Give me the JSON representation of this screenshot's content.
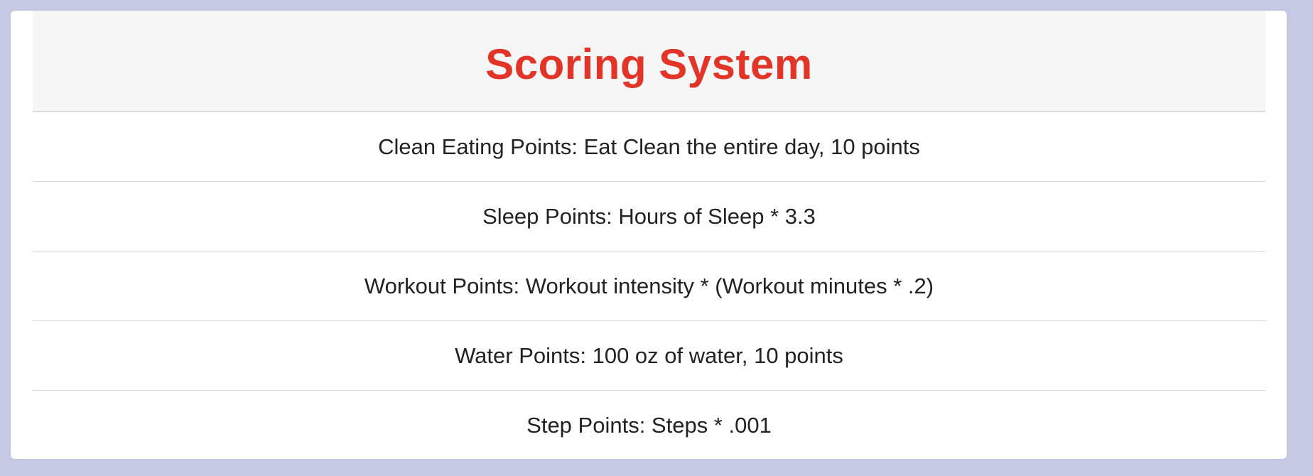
{
  "title": "Scoring System",
  "colors": {
    "page_background": "#c5c9e3",
    "card_background": "#ffffff",
    "header_background": "#f6f6f6",
    "title_color": "#e23528",
    "text_color": "#222222"
  },
  "rules": [
    "Clean Eating Points: Eat Clean the entire day, 10 points",
    "Sleep Points: Hours of Sleep * 3.3",
    "Workout Points: Workout intensity * (Workout minutes * .2)",
    "Water Points: 100 oz of water, 10 points",
    "Step Points: Steps * .001"
  ]
}
